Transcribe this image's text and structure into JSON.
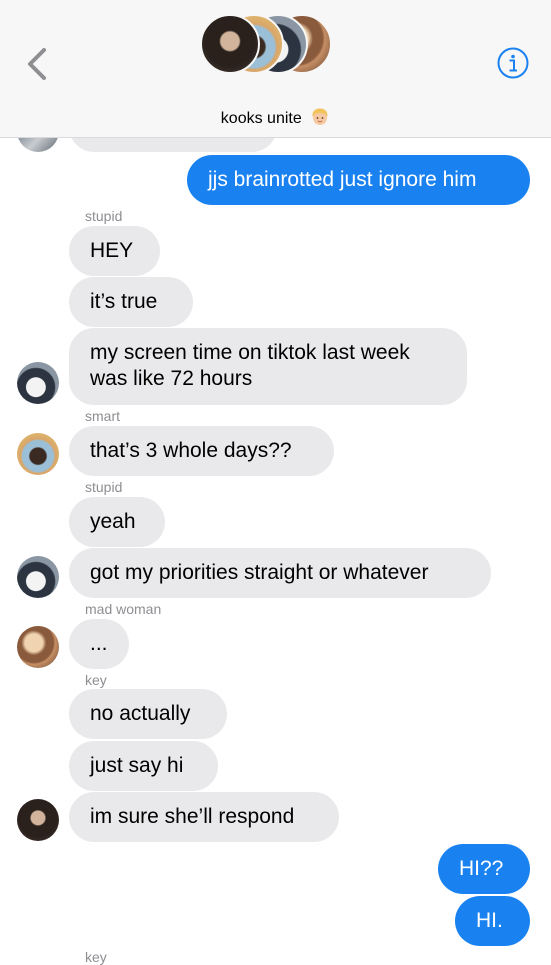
{
  "header": {
    "back_icon": "chevron-left-icon",
    "info_icon": "info-circle-icon",
    "title": "kooks unite",
    "title_emoji": "person-blond-hair-emoji",
    "accent_color": "#1a82f0"
  },
  "messages": {
    "m0": {
      "text": ""
    },
    "m1": {
      "text": "jjs brainrotted just ignore him"
    },
    "s1": {
      "name": "stupid"
    },
    "m2": {
      "text": "HEY"
    },
    "m3": {
      "text": "it’s true"
    },
    "m4": {
      "text": "my screen time on tiktok last week was like 72 hours"
    },
    "s2": {
      "name": "smart"
    },
    "m5": {
      "text": "that’s 3 whole days??"
    },
    "s3": {
      "name": "stupid"
    },
    "m6": {
      "text": "yeah"
    },
    "m7": {
      "text": "got my priorities straight or whatever"
    },
    "s4": {
      "name": "mad woman"
    },
    "m8": {
      "text": "..."
    },
    "s5": {
      "name": "key"
    },
    "m9": {
      "text": "no actually"
    },
    "m10": {
      "text": "just say hi"
    },
    "m11": {
      "text": "im sure she’ll respond"
    },
    "m12": {
      "text": "HI??"
    },
    "m13": {
      "text": "HI."
    },
    "s6": {
      "name": "key"
    }
  }
}
